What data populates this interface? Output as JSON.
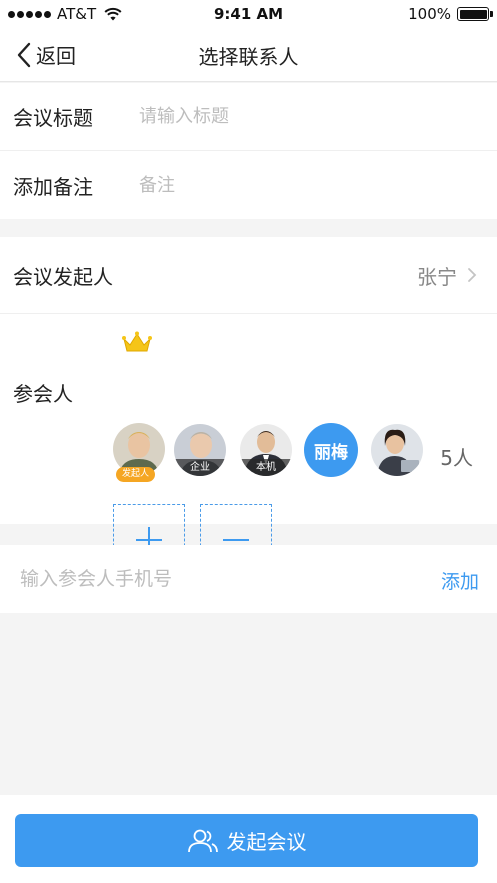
{
  "status_bar": {
    "carrier": "AT&T",
    "time": "9:41 AM",
    "battery": "100%",
    "battery_level": 1.0
  },
  "nav": {
    "back_label": "返回",
    "title": "选择联系人"
  },
  "form": {
    "title_label": "会议标题",
    "title_placeholder": "请输入标题",
    "note_label": "添加备注",
    "note_placeholder": "备注"
  },
  "initiator": {
    "label": "会议发起人",
    "value": "张宁"
  },
  "participants": {
    "label": "参会人",
    "avatars": [
      {
        "icon": "person-photo",
        "badge": "发起人",
        "crown": true
      },
      {
        "icon": "person-photo",
        "tag": "企业"
      },
      {
        "icon": "person-photo",
        "tag": "本机"
      },
      {
        "initials": "丽梅",
        "color": "#3d9af0"
      },
      {
        "icon": "person-photo"
      }
    ],
    "count": "5人",
    "add_icon": "plus-icon",
    "remove_icon": "minus-icon"
  },
  "phone": {
    "placeholder": "输入参会人手机号",
    "add_label": "添加"
  },
  "footer": {
    "start_label": "发起会议",
    "icon": "group-icon"
  },
  "colors": {
    "accent": "#3d9af0",
    "badge": "#f5a623",
    "background": "#f4f4f4"
  }
}
